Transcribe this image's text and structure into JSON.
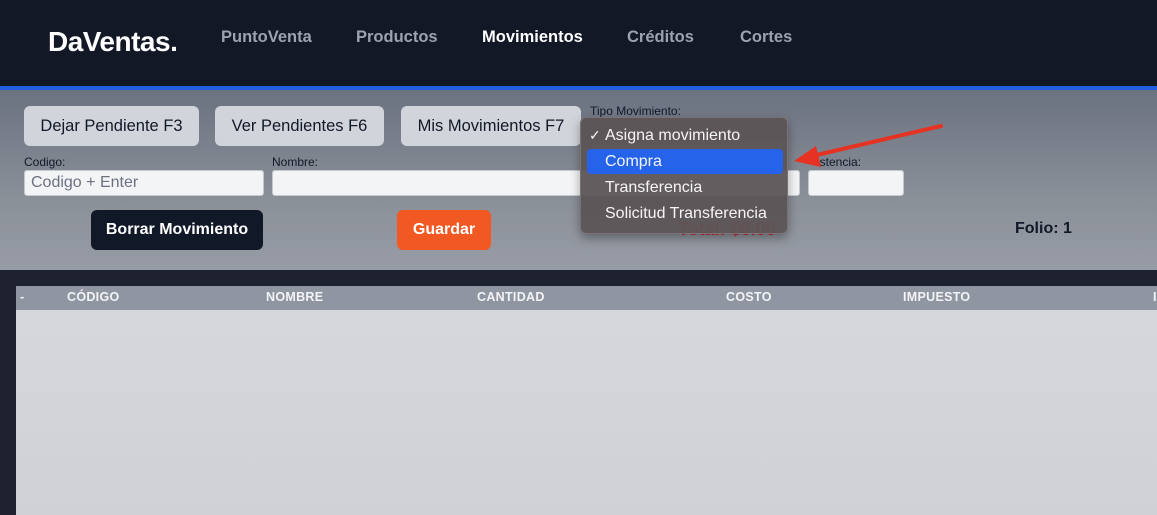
{
  "app": {
    "logo": "DaVentas."
  },
  "nav": [
    {
      "label": "PuntoVenta"
    },
    {
      "label": "Productos"
    },
    {
      "label": "Movimientos"
    },
    {
      "label": "Créditos"
    },
    {
      "label": "Cortes"
    }
  ],
  "toolbar": {
    "dejar_pendiente": "Dejar Pendiente F3",
    "ver_pendientes": "Ver Pendientes F6",
    "mis_movimientos": "Mis Movimientos F7"
  },
  "form": {
    "tipo_label": "Tipo Movimiento:",
    "codigo_label": "Codigo:",
    "codigo_placeholder": "Codigo + Enter",
    "nombre_label": "Nombre:",
    "existencia_label": "istencia:"
  },
  "actions": {
    "borrar": "Borrar Movimiento",
    "guardar": "Guardar",
    "total": "Total: $0.00",
    "folio": "Folio: 1"
  },
  "dropdown": {
    "options": [
      {
        "label": "Asigna movimiento",
        "checked": true
      },
      {
        "label": "Compra",
        "highlighted": true
      },
      {
        "label": "Transferencia"
      },
      {
        "label": "Solicitud Transferencia"
      }
    ]
  },
  "table": {
    "columns": [
      "-",
      "CÓDIGO",
      "NOMBRE",
      "CANTIDAD",
      "COSTO",
      "IMPUESTO",
      "I"
    ]
  },
  "colors": {
    "accent": "#1f5fe0",
    "guardar": "#f15822",
    "total": "#dc2626",
    "annotation_arrow": "#e53222"
  }
}
